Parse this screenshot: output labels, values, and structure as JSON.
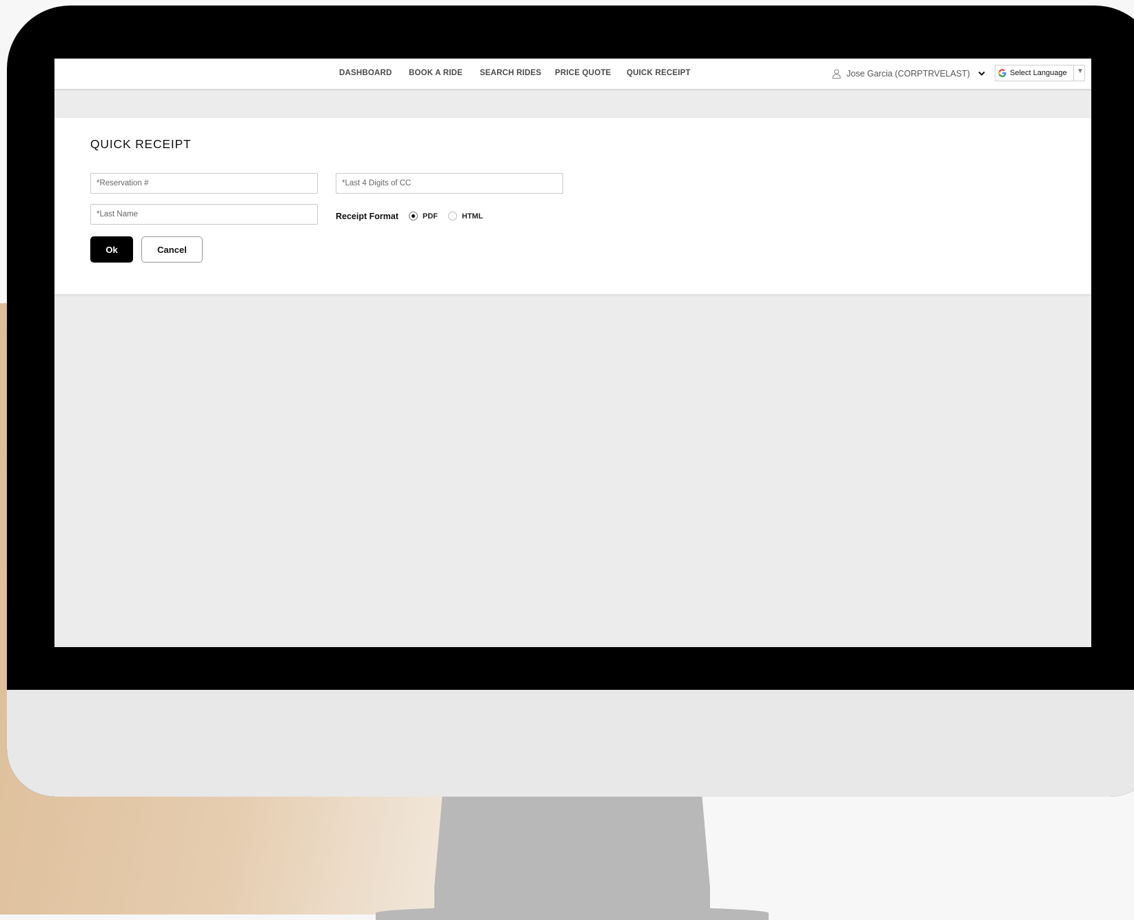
{
  "nav": {
    "items": [
      {
        "label": "DASHBOARD"
      },
      {
        "label": "BOOK A RIDE"
      },
      {
        "label": "SEARCH RIDES"
      },
      {
        "label": "PRICE QUOTE"
      },
      {
        "label": "QUICK RECEIPT"
      }
    ],
    "user": "Jose Garcia (CORPTRVELAST)",
    "language_label": "Select Language"
  },
  "page": {
    "title": "QUICK RECEIPT"
  },
  "form": {
    "reservation_placeholder": "*Reservation #",
    "cc_placeholder": "*Last 4 Digits of CC",
    "lastname_placeholder": "*Last Name",
    "format_label": "Receipt Format",
    "format_options": [
      {
        "label": "PDF",
        "selected": true
      },
      {
        "label": "HTML",
        "selected": false
      }
    ],
    "ok_label": "Ok",
    "cancel_label": "Cancel"
  },
  "icons": {
    "user": "user-icon",
    "chevron": "chevron-down-icon",
    "google": "google-icon",
    "dropdown": "dropdown-arrow-icon"
  }
}
